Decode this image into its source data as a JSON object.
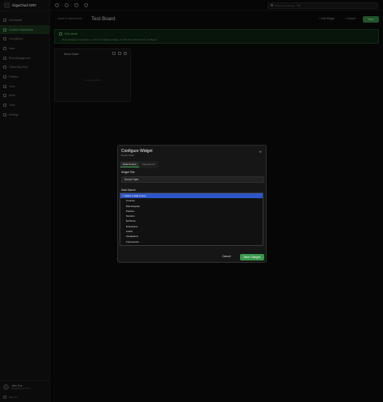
{
  "app": {
    "name": "GigaChad GRC"
  },
  "sidebar": {
    "items": [
      {
        "label": "Dashboard",
        "icon": "home-icon",
        "active": false,
        "chevron": false
      },
      {
        "label": "Custom Dashboards",
        "icon": "layout-icon",
        "active": true,
        "chevron": false
      },
      {
        "label": "Compliance",
        "icon": "shield-icon",
        "active": false,
        "chevron": true
      },
      {
        "label": "Data",
        "icon": "database-icon",
        "active": false,
        "chevron": true
      },
      {
        "label": "Risk Management",
        "icon": "alert-icon",
        "active": false,
        "chevron": true
      },
      {
        "label": "Third Party Risk",
        "icon": "building-icon",
        "active": false,
        "chevron": true
      },
      {
        "label": "Policies",
        "icon": "document-icon",
        "active": false,
        "chevron": true
      },
      {
        "label": "Trust",
        "icon": "check-icon",
        "active": false,
        "chevron": true
      },
      {
        "label": "Audit",
        "icon": "clipboard-icon",
        "active": false,
        "chevron": true
      },
      {
        "label": "Tools",
        "icon": "wrench-icon",
        "active": false,
        "chevron": true
      },
      {
        "label": "Settings",
        "icon": "gear-icon",
        "active": false,
        "chevron": true
      }
    ],
    "user": {
      "name": "John Doe",
      "email": "john@example.com"
    },
    "signout_label": "Sign out"
  },
  "topbar": {
    "search_placeholder": "Search everything... ⌘K"
  },
  "header": {
    "back_label": "← Back to dashboards",
    "title": "Test Board",
    "add_widget_label": "+ Add Widget",
    "cancel_label": "× Cancel",
    "save_label": "Save"
  },
  "banner": {
    "title": "Edit Mode",
    "description": "Drag widgets to reposition, resize by dragging edges, or click the edit button to configure."
  },
  "widget": {
    "title": "Donut Chart",
    "empty_text": "No data available"
  },
  "modal": {
    "title": "Configure Widget",
    "subtitle": "Donut Chart",
    "tabs": [
      "Data Source",
      "Appearance"
    ],
    "widget_title_label": "Widget Title",
    "widget_title_value": "Donut Chart",
    "data_source_label": "Data Source",
    "data_source_options": [
      "Select a data source",
      "Controls",
      "Risk Register",
      "Policies",
      "Vendors",
      "Evidence",
      "Employees",
      "Audits",
      "Integrations",
      "Frameworks"
    ],
    "selected_option": "Select a data source",
    "cancel_label": "Cancel",
    "save_label": "Save Changes"
  },
  "colors": {
    "accent": "#3a9a4c",
    "selection": "#2f56c8",
    "banner_bg": "#0f2713"
  }
}
